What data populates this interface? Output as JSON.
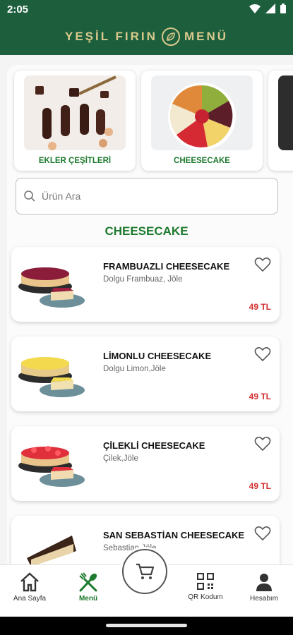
{
  "status_bar": {
    "time": "2:05"
  },
  "header": {
    "title_left": "YEŞİL FIRIN",
    "title_right": "MENÜ"
  },
  "categories": [
    {
      "label": "EKLER ÇEŞİTLERİ",
      "icon": "eclair-photo"
    },
    {
      "label": "CHEESECAKE",
      "icon": "cheesecake-photo"
    }
  ],
  "search": {
    "placeholder": "Ürün Ara"
  },
  "section": {
    "title": "CHEESECAKE"
  },
  "products": [
    {
      "name": "FRAMBUAZLI CHEESECAKE",
      "desc": "Dolgu Frambuaz, Jöle",
      "price": "49 TL"
    },
    {
      "name": "LİMONLU CHEESECAKE",
      "desc": "Dolgu Limon,Jöle",
      "price": "49 TL"
    },
    {
      "name": "ÇİLEKLİ CHEESECAKE",
      "desc": "Çilek,Jöle",
      "price": "49 TL"
    },
    {
      "name": "SAN SEBASTİAN CHEESECAKE",
      "desc": "Sebastian Jöle",
      "price": ""
    }
  ],
  "nav": {
    "home": "Ana Sayfa",
    "menu": "Menü",
    "qr": "QR Kodum",
    "account": "Hesabım"
  },
  "colors": {
    "brand_green": "#1d5f3d",
    "accent_green": "#1d7a2e",
    "gold": "#d9c98c",
    "price_red": "#d32f2f"
  }
}
